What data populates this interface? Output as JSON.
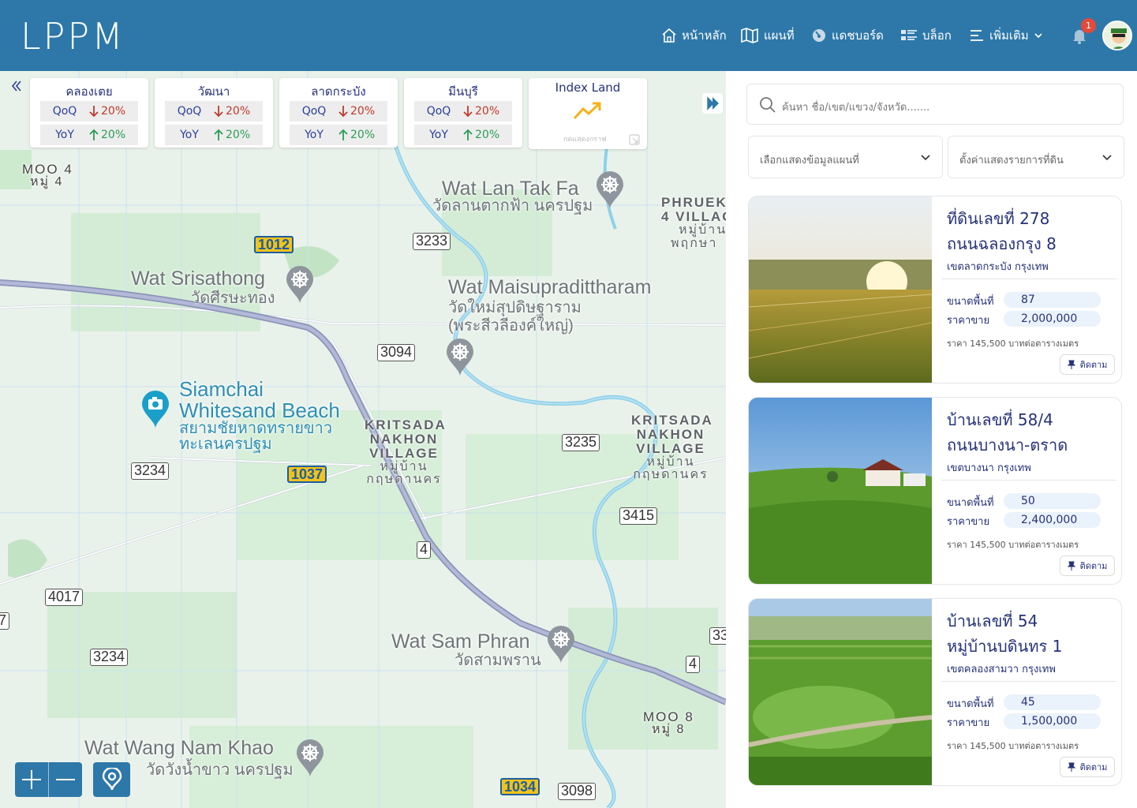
{
  "header": {
    "logo": "LPPM",
    "nav": [
      {
        "label": "หน้าหลัก",
        "icon": "home-icon"
      },
      {
        "label": "แผนที่",
        "icon": "map-icon"
      },
      {
        "label": "แดชบอร์ด",
        "icon": "dashboard-gauge-icon"
      },
      {
        "label": "บล็อก",
        "icon": "blog-list-icon"
      },
      {
        "label": "เพิ่มเติม",
        "icon": "menu-lines-icon",
        "dropdown": true
      }
    ],
    "notification_count": "1"
  },
  "stats": [
    {
      "district": "คลองเตย",
      "qoq_label": "QoQ",
      "qoq_value": "20%",
      "qoq_dir": "down",
      "yoy_label": "YoY",
      "yoy_value": "20%",
      "yoy_dir": "up"
    },
    {
      "district": "วัฒนา",
      "qoq_label": "QoQ",
      "qoq_value": "20%",
      "qoq_dir": "down",
      "yoy_label": "YoY",
      "yoy_value": "20%",
      "yoy_dir": "up"
    },
    {
      "district": "ลาดกระบัง",
      "qoq_label": "QoQ",
      "qoq_value": "20%",
      "qoq_dir": "down",
      "yoy_label": "YoY",
      "yoy_value": "20%",
      "yoy_dir": "up"
    },
    {
      "district": "มีนบุรี",
      "qoq_label": "QoQ",
      "qoq_value": "20%",
      "qoq_dir": "down",
      "yoy_label": "YoY",
      "yoy_value": "20%",
      "yoy_dir": "up"
    }
  ],
  "index_land": {
    "title": "Index Land",
    "caption": "กดแสดงกราฟ"
  },
  "map": {
    "places": [
      {
        "name": "Wat Lan Tak Fa",
        "thai": "วัดลานตากฟ้า นครปฐม"
      },
      {
        "name": "Wat Srisathong",
        "thai": "วัดศีรษะทอง"
      },
      {
        "name": "Wat Maisupradittharam",
        "thai": "วัดใหม่สุปดิษฐาราม",
        "thai2": "(พระสีวลีองค์ใหญ่)"
      },
      {
        "name": "Siamchai",
        "name2": "Whitesand Beach",
        "thai": "สยามชัยหาดทรายขาว",
        "thai2": "ทะเลนครปฐม"
      },
      {
        "name": "Wat Sam Phran",
        "thai": "วัดสามพราน"
      },
      {
        "name": "Wat Wang Nam Khao",
        "thai": "วัดวังน้ำขาว นครปฐม"
      }
    ],
    "villages": [
      {
        "l1": "KRITSADA",
        "l2": "NAKHON",
        "l3": "VILLAGE",
        "thai1": "หมู่บ้าน",
        "thai2": "กฤษดานคร"
      },
      {
        "l1": "KRITSADA",
        "l2": "NAKHON",
        "l3": "VILLAGE",
        "thai1": "หมู่บ้าน",
        "thai2": "กฤษดานคร"
      },
      {
        "l1": "PHRUEKS",
        "l2": "4 VILLAG",
        "thai1": "หมู่บ้าน",
        "thai2": "พฤกษา"
      }
    ],
    "moo": [
      {
        "en": "MOO 4",
        "th": "หมู่ 4"
      },
      {
        "en": "MOO 8",
        "th": "หมู่ 8"
      }
    ],
    "roads": [
      "1012",
      "3233",
      "3094",
      "3235",
      "1037",
      "3234",
      "3415",
      "4",
      "4017",
      "3234",
      "4",
      "1034",
      "3098",
      "33",
      "7"
    ]
  },
  "panel": {
    "search_placeholder": "ค้นหา ชื่อ/เขต/แขวง/จังหวัด.......",
    "select_map": "เลือกแสดงข้อมูลแผนที่",
    "select_land": "ตั้งค่าแสดงรายการที่ดิน",
    "listings": [
      {
        "title1": "ที่ดินเลขที่ 278",
        "title2": "ถนนฉลองกรุง 8",
        "location": "เขตลาดกระบัง กรุงเทพ",
        "area_label": "ขนาดพื้นที่",
        "area": "87",
        "price_label": "ราคาขาย",
        "price": "2,000,000",
        "per_sqm": "ราคา 145,500 บาทต่อตารางเมตร",
        "follow": "ติดตาม"
      },
      {
        "title1": "บ้านเลขที่ 58/4",
        "title2": "ถนนบางนา-ตราด",
        "location": "เขตบางนา กรุงเทพ",
        "area_label": "ขนาดพื้นที่",
        "area": "50",
        "price_label": "ราคาขาย",
        "price": "2,400,000",
        "per_sqm": "ราคา 145,500 บาทต่อตารางเมตร",
        "follow": "ติดตาม"
      },
      {
        "title1": "บ้านเลขที่ 54",
        "title2": "หมู่บ้านบดินทร 1",
        "location": "เขตคลองสามวา กรุงเทพ",
        "area_label": "ขนาดพื้นที่",
        "area": "45",
        "price_label": "ราคาขาย",
        "price": "1,500,000",
        "per_sqm": "ราคา 145,500 บาทต่อตารางเมตร",
        "follow": "ติดตาม"
      }
    ]
  },
  "colors": {
    "header": "#2e78a9",
    "text": "#26327a",
    "down": "#c0392b",
    "up": "#2a9d55"
  }
}
